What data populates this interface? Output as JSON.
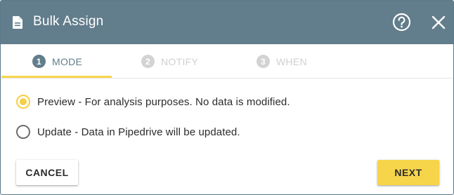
{
  "dialog": {
    "title": "Bulk Assign",
    "icons": {
      "title_icon": "document-icon",
      "help": "help-circle-icon",
      "close": "close-icon"
    }
  },
  "steps": [
    {
      "number": "1",
      "label": "MODE",
      "active": true
    },
    {
      "number": "2",
      "label": "NOTIFY",
      "active": false
    },
    {
      "number": "3",
      "label": "WHEN",
      "active": false
    }
  ],
  "mode_options": [
    {
      "label": "Preview - For analysis purposes. No data is modified.",
      "selected": true
    },
    {
      "label": "Update - Data in Pipedrive will be updated.",
      "selected": false
    }
  ],
  "footer": {
    "cancel_label": "CANCEL",
    "next_label": "NEXT"
  },
  "colors": {
    "header": "#627d8b",
    "accent": "#f7d54a",
    "inactive_step": "#d3d3d3"
  }
}
